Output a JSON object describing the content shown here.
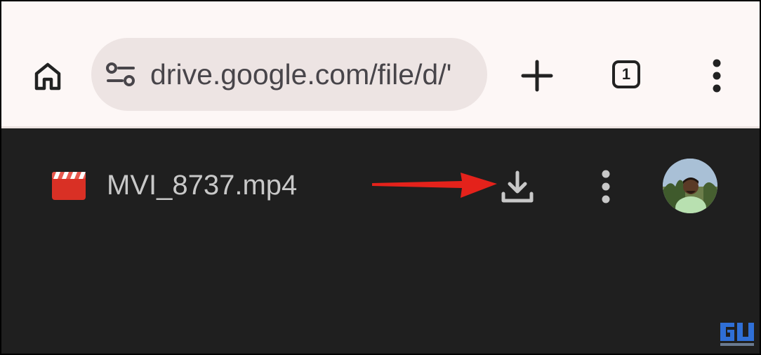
{
  "browser": {
    "url": "drive.google.com/file/d/'",
    "tab_count": "1",
    "icons": {
      "home": "home-icon",
      "site_settings": "tune-icon",
      "new_tab": "plus-icon",
      "tabs": "tab-switcher-icon",
      "menu": "more-vert-icon"
    }
  },
  "file_header": {
    "file_name": "MVI_8737.mp4",
    "file_icon": "video-file-icon",
    "actions": [
      "download-icon",
      "more-vert-icon",
      "avatar"
    ]
  },
  "annotation": {
    "arrow_color": "#e4221b",
    "points_to": "download"
  },
  "colors": {
    "toolbar_bg": "#fdf7f6",
    "omnibox_bg": "#ede4e3",
    "content_bg": "#1f1f1f",
    "video_icon": "#d93025",
    "header_text": "#c8c8c8"
  }
}
